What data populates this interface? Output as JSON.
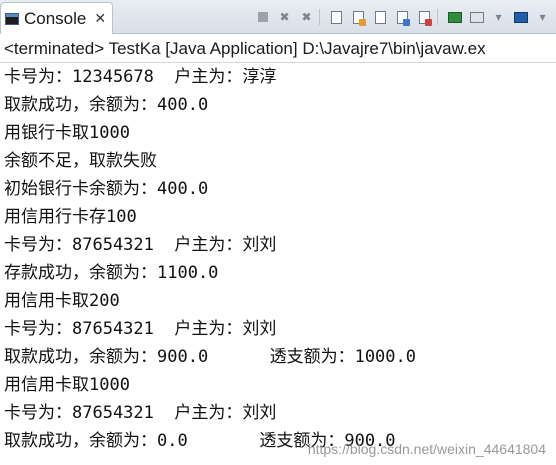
{
  "tab": {
    "label": "Console",
    "close_icon": "close-icon"
  },
  "header": {
    "text": "<terminated> TestKa [Java Application] D:\\Javajre7\\bin\\javaw.ex"
  },
  "lines": [
    "卡号为：12345678  户主为：淳淳",
    "取款成功，余额为：400.0",
    "用银行卡取1000",
    "余额不足，取款失败",
    "初始银行卡余额为：400.0",
    "用信用行卡存100",
    "卡号为：87654321  户主为：刘刘",
    "存款成功，余额为：1100.0",
    "用信用卡取200",
    "卡号为：87654321  户主为：刘刘",
    "取款成功，余额为：900.0      透支额为：1000.0",
    "用信用卡取1000",
    "卡号为：87654321  户主为：刘刘",
    "取款成功，余额为：0.0       透支额为：900.0"
  ],
  "watermark": "https://blog.csdn.net/weixin_44641804",
  "colors": {
    "tabbar": "#e1e6ee",
    "text": "#111111"
  }
}
